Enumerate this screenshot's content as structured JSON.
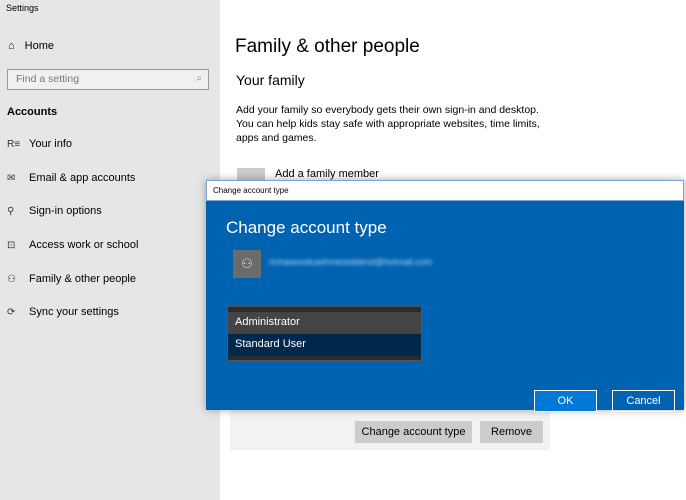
{
  "app_title": "Settings",
  "sidebar": {
    "home": "Home",
    "search_placeholder": "Find a setting",
    "section": "Accounts",
    "items": [
      {
        "label": "Your info",
        "icon": "id-card-icon",
        "glyph": "R≡"
      },
      {
        "label": "Email & app accounts",
        "icon": "mail-icon",
        "glyph": "✉"
      },
      {
        "label": "Sign-in options",
        "icon": "key-icon",
        "glyph": "⚲"
      },
      {
        "label": "Access work or school",
        "icon": "briefcase-icon",
        "glyph": "⊡"
      },
      {
        "label": "Family & other people",
        "icon": "add-person-icon",
        "glyph": "⚇"
      },
      {
        "label": "Sync your settings",
        "icon": "sync-icon",
        "glyph": "⟳"
      }
    ]
  },
  "main": {
    "title": "Family & other people",
    "subtitle": "Your family",
    "description": "Add your family so everybody gets their own sign-in and desktop. You can help kids stay safe with appropriate websites, time limits, apps and games.",
    "add_family": "Add a family member",
    "change_type_button": "Change account type",
    "remove_button": "Remove"
  },
  "dialog": {
    "window_title": "Change account type",
    "heading": "Change account type",
    "email": "richawoodcashmereddend@hotmail.com",
    "options": [
      "Administrator",
      "Standard User"
    ],
    "selected": "Standard User",
    "ok": "OK",
    "cancel": "Cancel"
  }
}
